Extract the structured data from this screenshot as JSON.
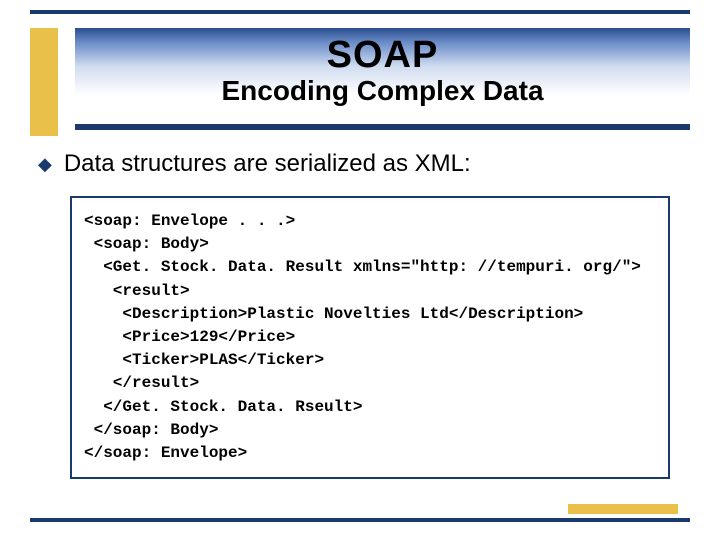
{
  "header": {
    "title": "SOAP",
    "subtitle": "Encoding Complex Data"
  },
  "bullet": {
    "text": "Data structures are serialized as XML:"
  },
  "code": {
    "lines": [
      "<soap: Envelope . . .>",
      " <soap: Body>",
      "  <Get. Stock. Data. Result xmlns=\"http: //tempuri. org/\">",
      "   <result>",
      "    <Description>Plastic Novelties Ltd</Description>",
      "    <Price>129</Price>",
      "    <Ticker>PLAS</Ticker>",
      "   </result>",
      "  </Get. Stock. Data. Rseult>",
      " </soap: Body>",
      "</soap: Envelope>"
    ]
  }
}
